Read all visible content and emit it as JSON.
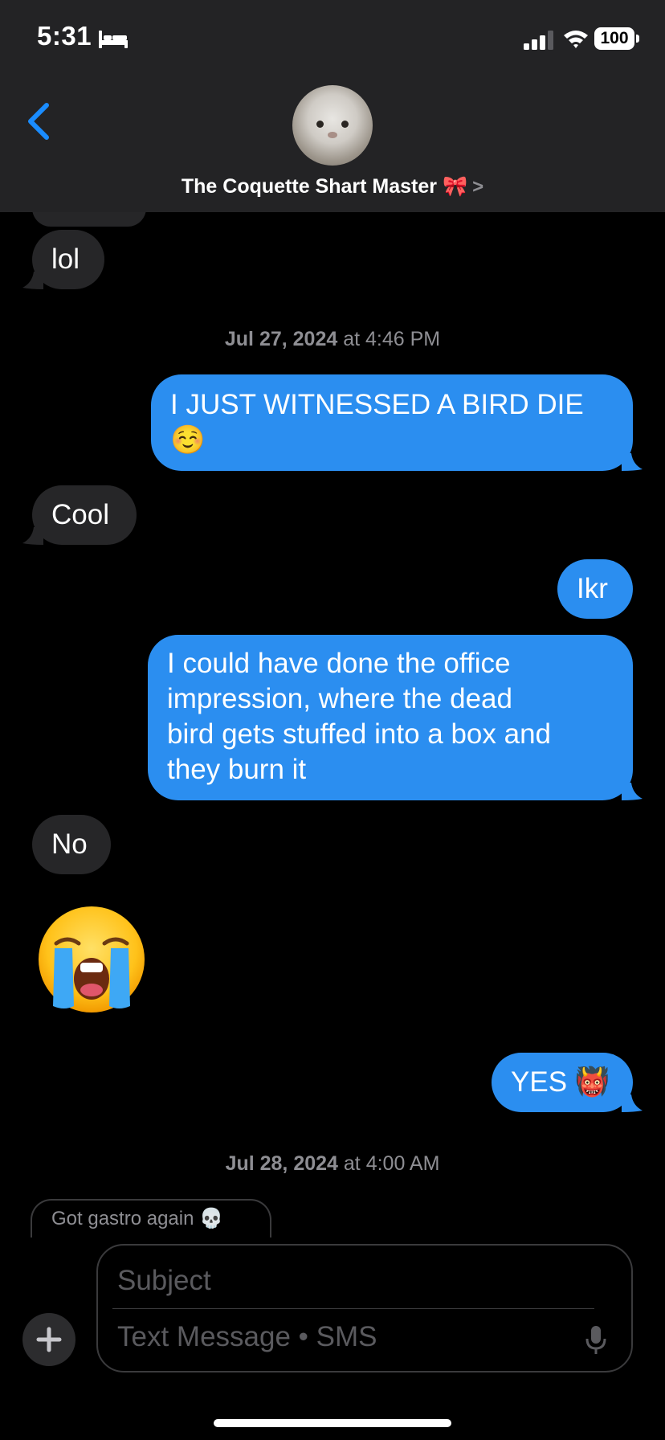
{
  "status_bar": {
    "time": "5:31",
    "battery": "100"
  },
  "header": {
    "contact_name": "The Coquette Shart Master 🎀",
    "chevron": ">"
  },
  "messages": {
    "m1": "lol",
    "ts1_date": "Jul 27, 2024",
    "ts1_at": " at ",
    "ts1_time": "4:46 PM",
    "m2_line1": "I JUST WITNESSED A BIRD DIE",
    "m2_line2": "☺️",
    "m3": "Cool",
    "m4": "Ikr",
    "m5_line1": "I could have done the office",
    "m5_line2": "impression, where the dead",
    "m5_line3": "bird gets stuffed into a box and",
    "m5_line4": "they burn it",
    "m6": "No",
    "m8": "YES 👹",
    "ts2_date": "Jul 28, 2024",
    "ts2_at": " at ",
    "ts2_time": "4:00 AM",
    "reply_preview": "Got gastro again 💀"
  },
  "compose": {
    "subject_placeholder": "Subject",
    "text_placeholder": "Text Message • SMS"
  },
  "colors": {
    "background": "#000000",
    "header": "#232325",
    "incoming_bubble": "#262628",
    "outgoing_bubble": "#2b8ef0",
    "timestamp": "#8e8e93",
    "link_blue": "#1a8cff"
  },
  "icons": {
    "back": "chevron-left-icon",
    "bed": "bed-icon",
    "signal": "signal-icon",
    "wifi": "wifi-icon",
    "plus": "plus-icon",
    "mic": "microphone-icon",
    "big_emoji": "loudly-crying-face-icon"
  }
}
